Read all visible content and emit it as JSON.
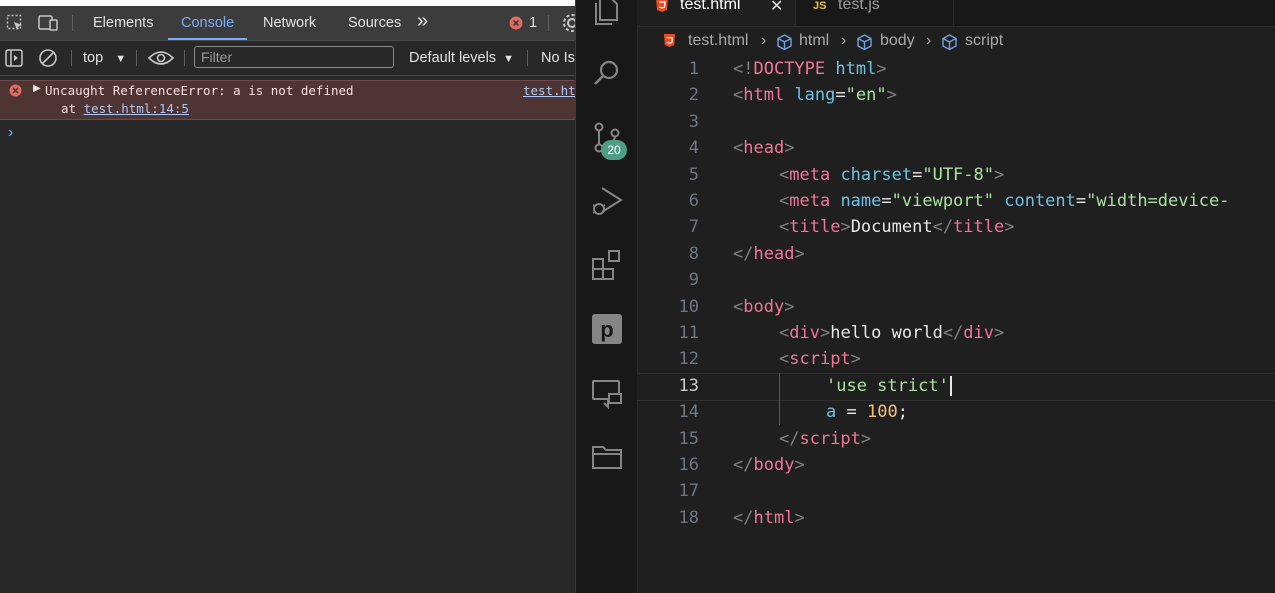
{
  "devtools": {
    "tabs": {
      "elements": "Elements",
      "console": "Console",
      "network": "Network",
      "sources": "Sources",
      "more": "»"
    },
    "error_count": "1",
    "toolbar": {
      "context": "top",
      "filter_placeholder": "Filter",
      "levels": "Default levels",
      "no_issues": "No Is"
    },
    "error": {
      "message": "Uncaught ReferenceError: a is not defined",
      "at_prefix": "at ",
      "location": "test.html:14:5",
      "source_link": "test.ht"
    },
    "prompt": "›"
  },
  "vscode": {
    "tabs": [
      {
        "label": "test.html",
        "close": "✕"
      },
      {
        "label": "test.js"
      }
    ],
    "badge": "20",
    "breadcrumb": [
      "test.html",
      "html",
      "body",
      "script"
    ],
    "gutter": [
      "1",
      "2",
      "3",
      "4",
      "5",
      "6",
      "7",
      "8",
      "9",
      "10",
      "11",
      "12",
      "13",
      "14",
      "15",
      "16",
      "17",
      "18"
    ],
    "code": {
      "l1": [
        "<!",
        "DOCTYPE",
        " html",
        ">"
      ],
      "l2": [
        "<",
        "html",
        " lang",
        "=",
        "\"en\"",
        ">"
      ],
      "l4": [
        "<",
        "head",
        ">"
      ],
      "l5": [
        "<",
        "meta",
        " charset",
        "=",
        "\"UTF-8\"",
        ">"
      ],
      "l6": [
        "<",
        "meta",
        " name",
        "=",
        "\"viewport\"",
        " content",
        "=",
        "\"width=device-"
      ],
      "l7": [
        "<",
        "title",
        ">",
        "Document",
        "</",
        "title",
        ">"
      ],
      "l8": [
        "</",
        "head",
        ">"
      ],
      "l10": [
        "<",
        "body",
        ">"
      ],
      "l11": [
        "<",
        "div",
        ">",
        "hello world",
        "</",
        "div",
        ">"
      ],
      "l12": [
        "<",
        "script",
        ">"
      ],
      "l13": [
        "'use strict'"
      ],
      "l14": [
        "a",
        " = ",
        "100",
        ";"
      ],
      "l15": [
        "</",
        "script",
        ">"
      ],
      "l16": [
        "</",
        "body",
        ">"
      ],
      "l18": [
        "</",
        "html",
        ">"
      ]
    }
  }
}
